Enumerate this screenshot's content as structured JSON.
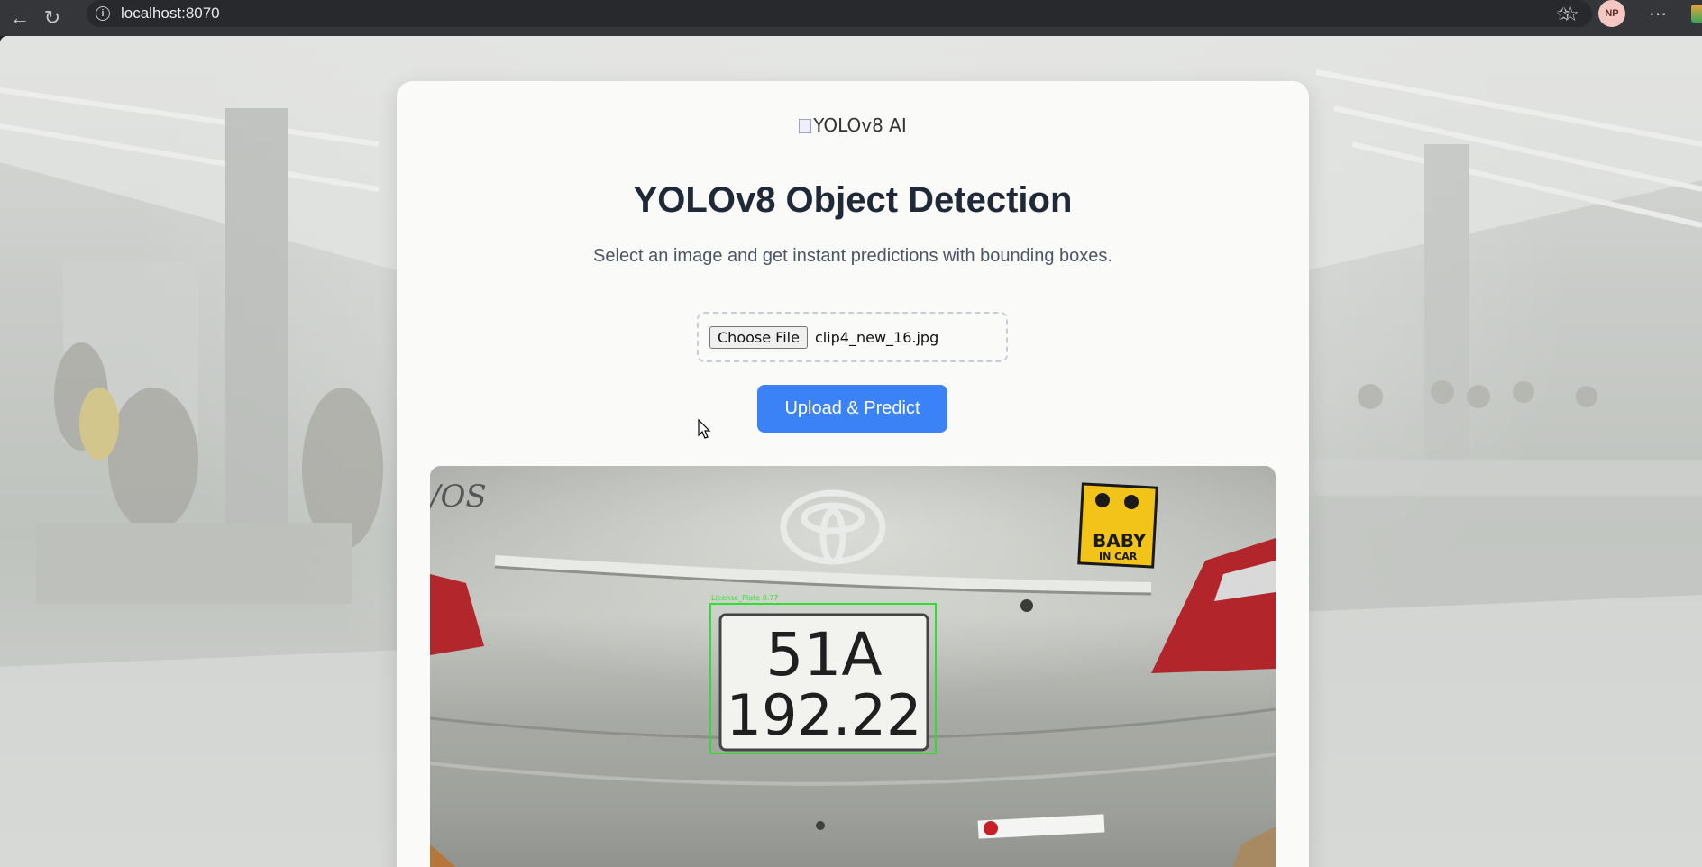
{
  "browser": {
    "url": "localhost:8070",
    "avatar_initials": "NP",
    "more_label": "⋯"
  },
  "page": {
    "logo_alt": "YOLOv8 AI",
    "title": "YOLOv8 Object Detection",
    "subtitle": "Select an image and get instant predictions with bounding boxes.",
    "choose_file_label": "Choose File",
    "file_name": "clip4_new_16.jpg",
    "predict_label": "Upload & Predict",
    "accent_color": "#3b82f6"
  },
  "result": {
    "detection_label": "License_Plate 0.77",
    "plate_line1": "51A",
    "plate_line2": "192.22",
    "sticker_line1": "BABY",
    "sticker_line2": "IN CAR"
  }
}
